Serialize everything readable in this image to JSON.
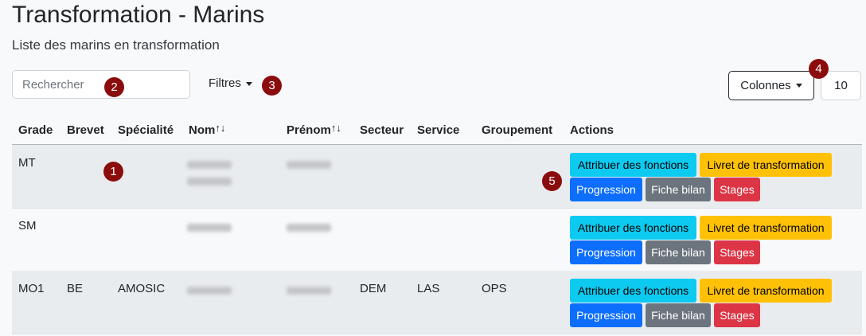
{
  "page": {
    "title": "Transformation - Marins",
    "subtitle": "Liste des marins en transformation"
  },
  "toolbar": {
    "search_placeholder": "Rechercher",
    "filters_label": "Filtres",
    "columns_label": "Colonnes",
    "page_size": "10"
  },
  "markers": [
    "1",
    "2",
    "3",
    "4",
    "5"
  ],
  "table": {
    "headers": [
      "Grade",
      "Brevet",
      "Spécialité",
      "Nom",
      "Prénom",
      "Secteur",
      "Service",
      "Groupement",
      "Actions"
    ],
    "sort_glyph": "↑↓",
    "rows": [
      {
        "grade": "MT",
        "brevet": "",
        "specialite": "",
        "secteur": "",
        "service": "",
        "groupement": ""
      },
      {
        "grade": "SM",
        "brevet": "",
        "specialite": "",
        "secteur": "",
        "service": "",
        "groupement": ""
      },
      {
        "grade": "MO1",
        "brevet": "BE",
        "specialite": "AMOSIC",
        "secteur": "DEM",
        "service": "LAS",
        "groupement": "OPS"
      }
    ],
    "actions": {
      "assign": "Attribuer des fonctions",
      "booklet": "Livret de transformation",
      "progress": "Progression",
      "summary": "Fiche bilan",
      "internships": "Stages"
    }
  },
  "colors": {
    "marker": "#8b0c0c",
    "info": "#0dcaf0",
    "warning": "#ffc107",
    "primary": "#0d6efd",
    "secondary": "#6c757d",
    "danger": "#dc3545"
  }
}
